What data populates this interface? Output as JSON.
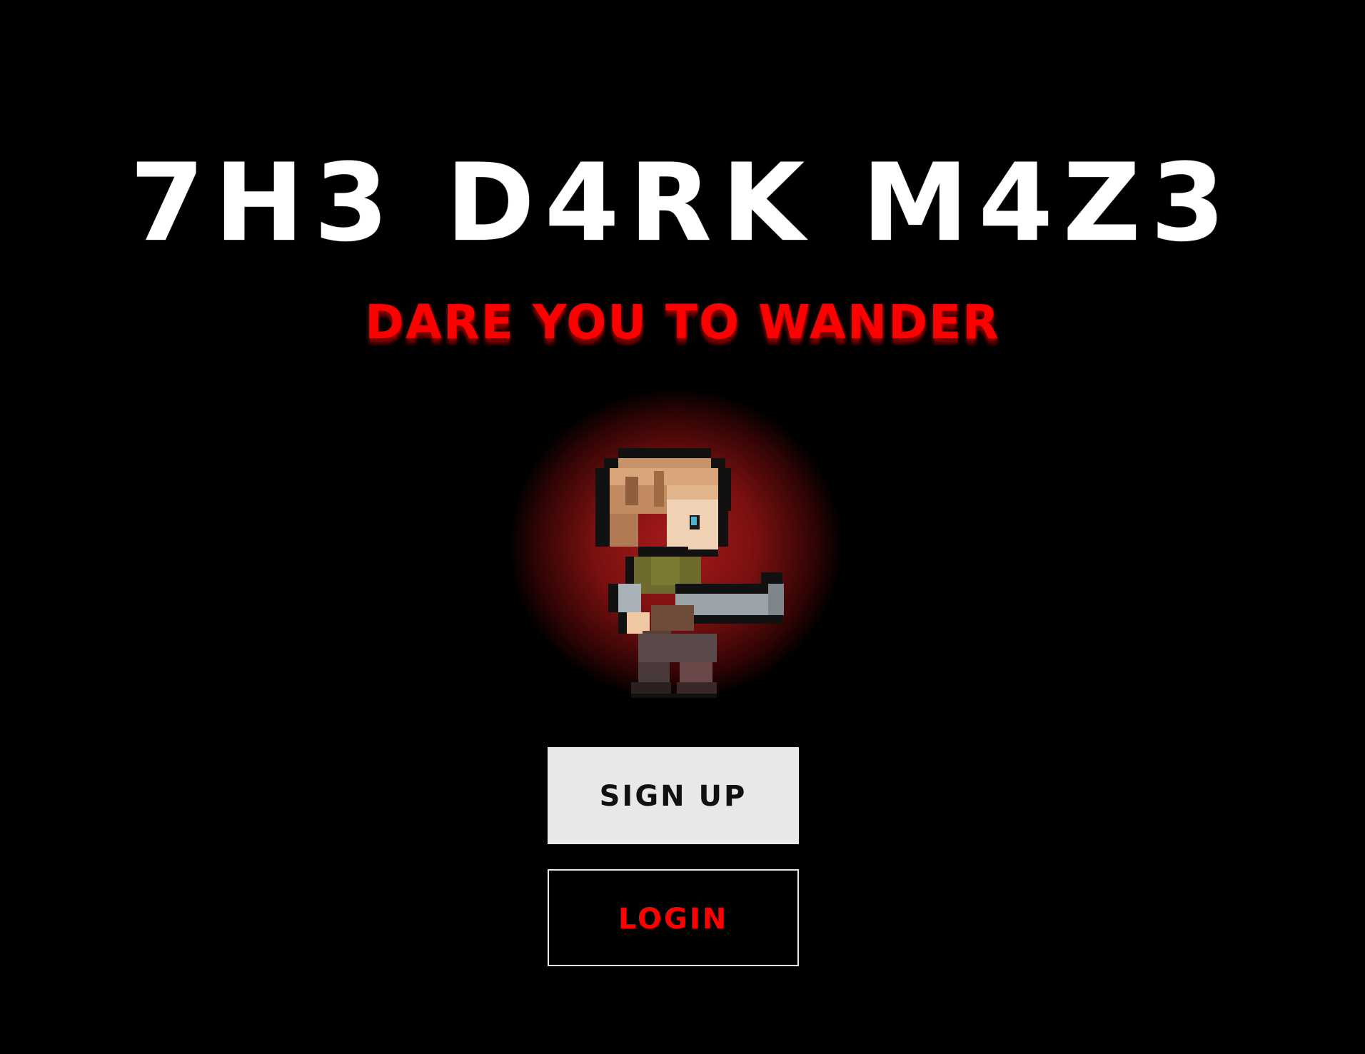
{
  "game": {
    "title": "7H3 D4RK M4Z3",
    "tagline": "DARE YOU TO WANDER"
  },
  "hero": {
    "icon": "pixel-soldier-with-shotgun"
  },
  "buttons": {
    "signup_label": "SIGN UP",
    "login_label": "LOGIN"
  },
  "colors": {
    "background": "#000000",
    "title": "#ffffff",
    "accent": "#ff0000",
    "button_light": "#e8e8e8"
  }
}
